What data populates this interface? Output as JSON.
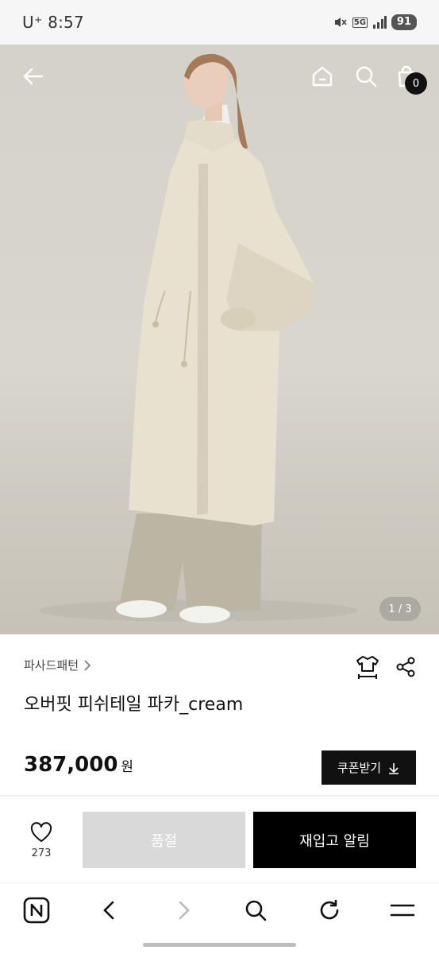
{
  "status_bar": {
    "time": "8:57",
    "carrier": "U⁺",
    "battery": "91",
    "network": "5G"
  },
  "header": {
    "icons": [
      "back-arrow-icon",
      "home-icon",
      "search-icon",
      "shopping-bag-icon"
    ],
    "cart_count": "0"
  },
  "gallery": {
    "indicator": "1 / 3",
    "current": 1,
    "total": 3
  },
  "product": {
    "brand": "파사드패턴",
    "name": "오버핏 피쉬테일 파카_cream",
    "price": "387,000",
    "currency": "원"
  },
  "coupon": {
    "label": "쿠폰받기"
  },
  "purchase_bar": {
    "like_count": "273",
    "soldout_label": "품절",
    "restock_label": "재입고 알림"
  },
  "browser_nav": {
    "icons": [
      "n-logo-icon",
      "back-icon",
      "forward-icon",
      "search-icon",
      "refresh-icon",
      "menu-icon"
    ]
  },
  "colors": {
    "accent": "#000000",
    "soldout": "#d9d9d9",
    "coat": "#e8e1d0",
    "background": "#d5d2ca"
  }
}
